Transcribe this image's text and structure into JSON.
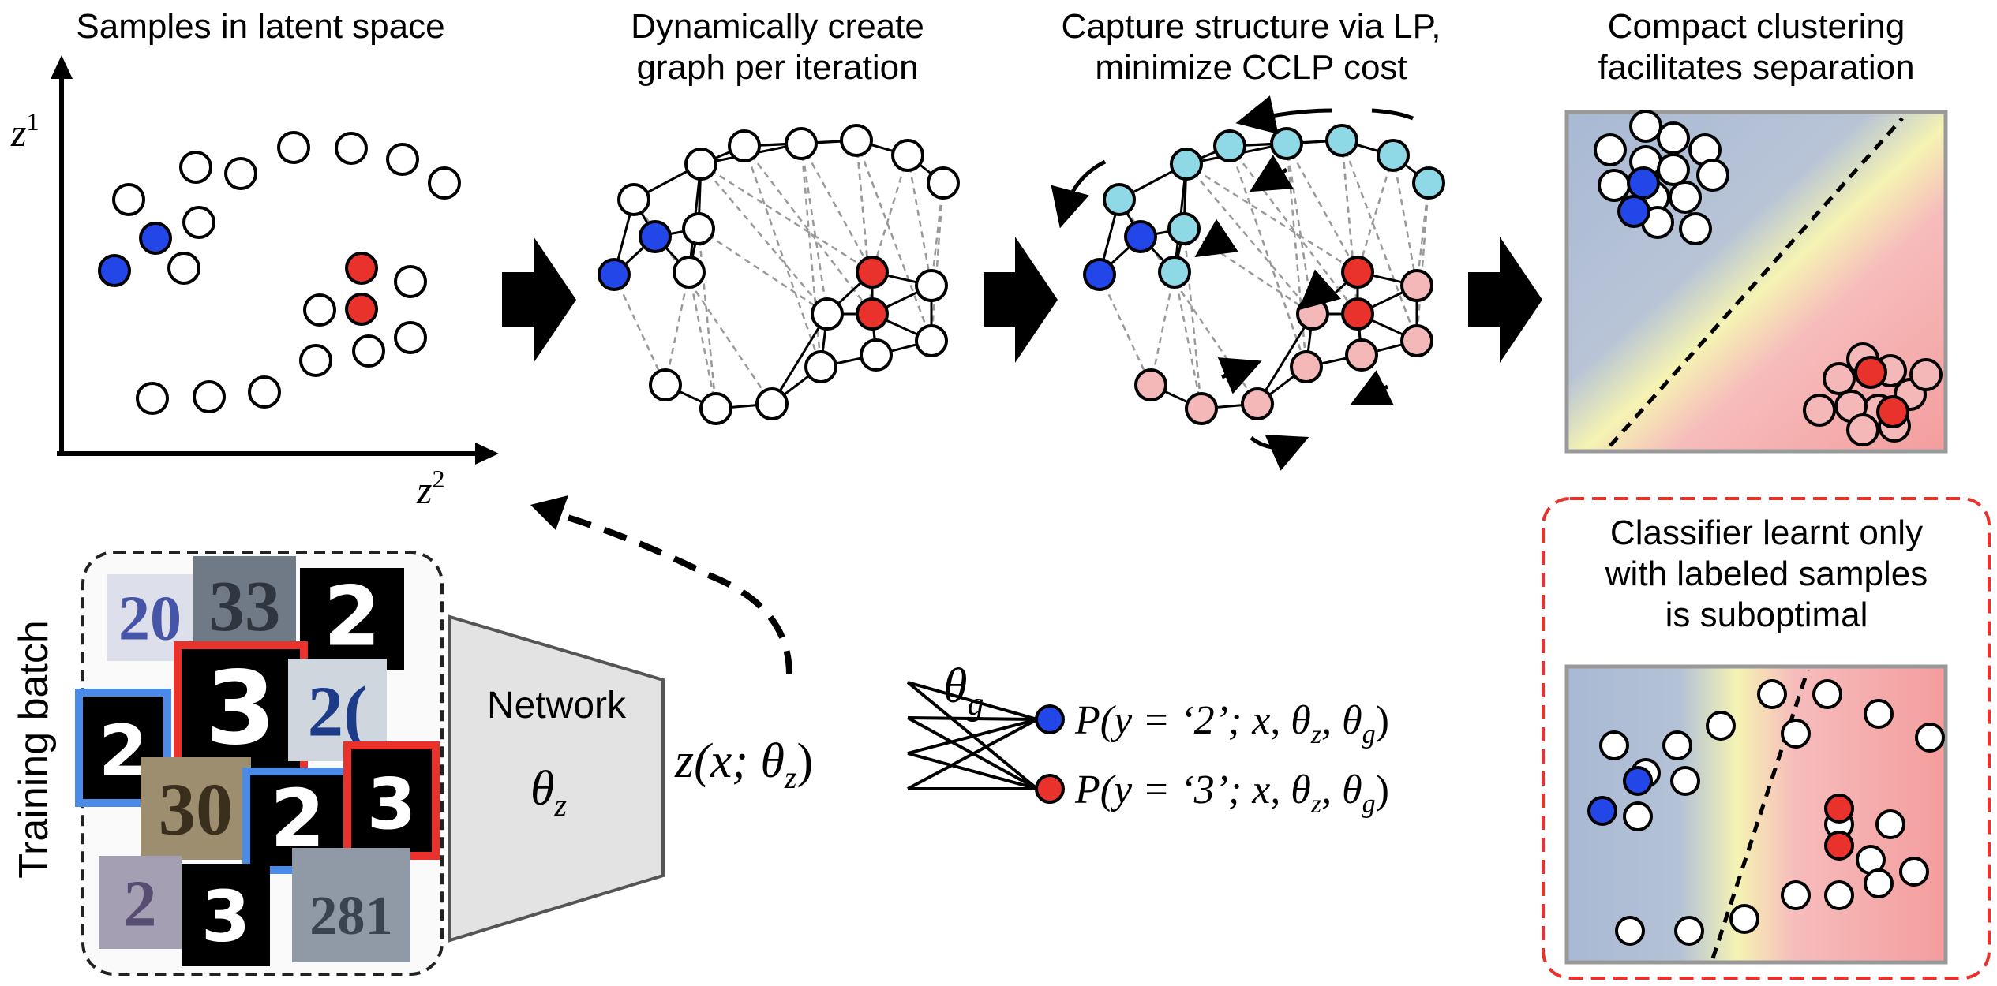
{
  "panels": {
    "latent": {
      "title": "Samples in latent space",
      "axis_y_label": "z",
      "axis_y_sup": "1",
      "axis_x_label": "z",
      "axis_x_sup": "2"
    },
    "graph": {
      "title_line1": "Dynamically create",
      "title_line2": "graph per iteration"
    },
    "lp": {
      "title_line1": "Capture structure via LP,",
      "title_line2": "minimize CCLP cost"
    },
    "compact": {
      "title_line1": "Compact clustering",
      "title_line2": "facilitates separation"
    },
    "suboptimal": {
      "title_line1": "Classifier learnt only",
      "title_line2": "with labeled samples",
      "title_line3": "is suboptimal"
    }
  },
  "training": {
    "label": "Training batch",
    "digits": [
      {
        "text": "20",
        "style": "svhn"
      },
      {
        "text": "33",
        "style": "svhn"
      },
      {
        "text": "2",
        "style": "mnist"
      },
      {
        "text": "3",
        "style": "mnist",
        "label": "red"
      },
      {
        "text": "2(",
        "style": "svhn"
      },
      {
        "text": "2",
        "style": "mnist",
        "label": "blue"
      },
      {
        "text": "30",
        "style": "svhn"
      },
      {
        "text": "2",
        "style": "mnist",
        "label": "blue"
      },
      {
        "text": "3",
        "style": "mnist",
        "label": "red"
      },
      {
        "text": "2",
        "style": "svhn"
      },
      {
        "text": "3",
        "style": "mnist"
      },
      {
        "text": "281",
        "style": "svhn"
      }
    ]
  },
  "network": {
    "label": "Network",
    "param": "θ",
    "param_sub": "z"
  },
  "embedding": {
    "text": "z(x; θ",
    "sub": "z",
    "close": ")"
  },
  "classifier": {
    "param": "θ",
    "param_sub": "g",
    "outputs": [
      {
        "class": "2",
        "color": "#2346e8",
        "text_pre": "P(y = ‘2’; x, θ",
        "text_mid": ", θ",
        "text_end": ")"
      },
      {
        "class": "3",
        "color": "#e8322b",
        "text_pre": "P(y = ‘3’; x, θ",
        "text_mid": ", θ",
        "text_end": ")"
      }
    ]
  },
  "colors": {
    "labeled_blue": "#2346e8",
    "labeled_red": "#e8322b",
    "propagated_blue": "#8fd8e6",
    "propagated_red": "#f5b8b8",
    "unlabeled": "#ffffff",
    "bg_blue": "#a9b9d4",
    "bg_yellow": "#f5f3b3",
    "bg_red": "#f4a1a1",
    "dashed_box": "#e8322b"
  }
}
